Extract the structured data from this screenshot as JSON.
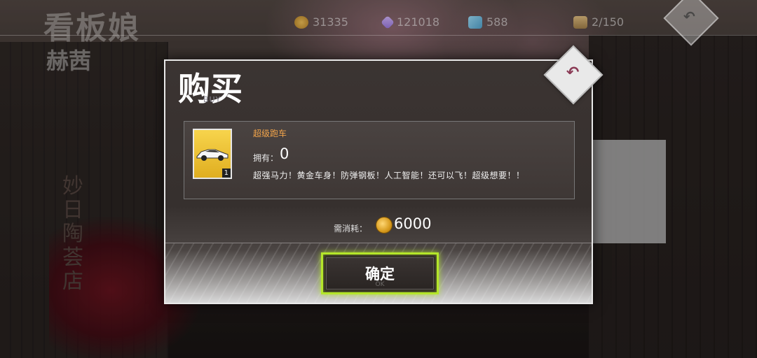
{
  "header": {
    "page_title": "看板娘",
    "character_name": "赫茜",
    "resources": [
      {
        "icon": "gold-coin-icon",
        "value": "31335"
      },
      {
        "icon": "crystal-icon",
        "value": "121018"
      },
      {
        "icon": "gem-icon",
        "value": "588"
      },
      {
        "icon": "inventory-box-icon",
        "value": "2/150"
      }
    ],
    "back_icon": "back-arrow-icon"
  },
  "background": {
    "sign_text": "妙 日 陶 荟 店"
  },
  "dialog": {
    "title": "购买",
    "title_en": "BUY",
    "close_icon": "back-arrow-icon",
    "item": {
      "name": "超级跑车",
      "icon": "sports-car-icon",
      "count_badge": "1",
      "own_label": "拥有：",
      "own_value": "0",
      "description": "超强马力！黄金车身！防弹钢板！人工智能！还可以飞！超级想要！！"
    },
    "cost": {
      "label": "需消耗：",
      "currency_icon": "gold-coin-icon",
      "value": "6000"
    },
    "confirm": {
      "label": "确定",
      "sub_label": "OK"
    }
  },
  "colors": {
    "accent_green": "#b4e62a",
    "item_name_orange": "#f2a44a",
    "dialog_bg": "#3b3432"
  }
}
